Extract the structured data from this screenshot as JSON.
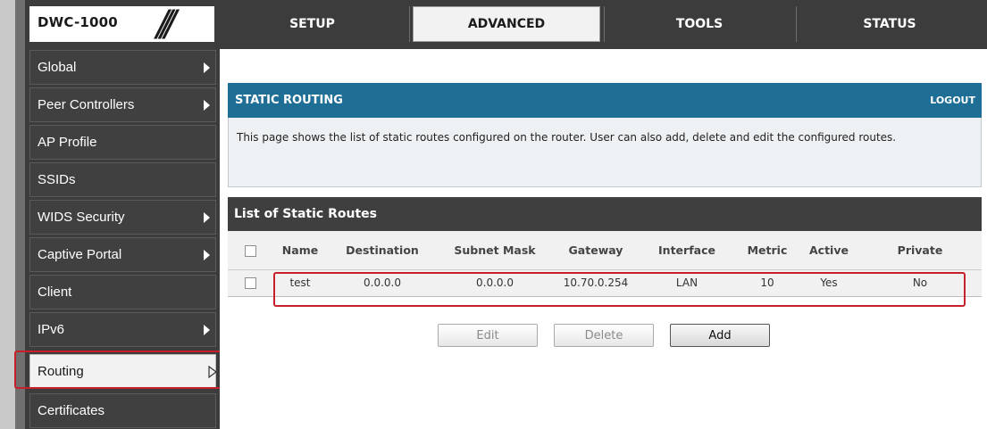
{
  "logo": {
    "model": "DWC-1000",
    "slashes": "///"
  },
  "tabs": [
    {
      "label": "SETUP"
    },
    {
      "label": "ADVANCED"
    },
    {
      "label": "TOOLS"
    },
    {
      "label": "STATUS"
    }
  ],
  "sidebar": {
    "items": [
      {
        "label": "Global"
      },
      {
        "label": "Peer Controllers"
      },
      {
        "label": "AP Profile"
      },
      {
        "label": "SSIDs"
      },
      {
        "label": "WIDS Security"
      },
      {
        "label": "Captive Portal"
      },
      {
        "label": "Client"
      },
      {
        "label": "IPv6"
      },
      {
        "label": "Routing"
      },
      {
        "label": "Certificates"
      }
    ]
  },
  "panel": {
    "title": "STATIC ROUTING",
    "logout": "LOGOUT",
    "description": "This page shows the list of static routes configured on the router. User can also add, delete and edit the configured routes."
  },
  "list": {
    "title": "List of Static Routes",
    "columns": [
      "Name",
      "Destination",
      "Subnet Mask",
      "Gateway",
      "Interface",
      "Metric",
      "Active",
      "Private"
    ],
    "rows": [
      {
        "name": "test",
        "destination": "0.0.0.0",
        "subnet_mask": "0.0.0.0",
        "gateway": "10.70.0.254",
        "interface": "LAN",
        "metric": "10",
        "active": "Yes",
        "private": "No"
      }
    ]
  },
  "buttons": {
    "edit": "Edit",
    "delete": "Delete",
    "add": "Add"
  },
  "colors": {
    "header_blue": "#1f6e96",
    "dark_bg": "#3c3c3c",
    "highlight_red": "#c8202a"
  }
}
